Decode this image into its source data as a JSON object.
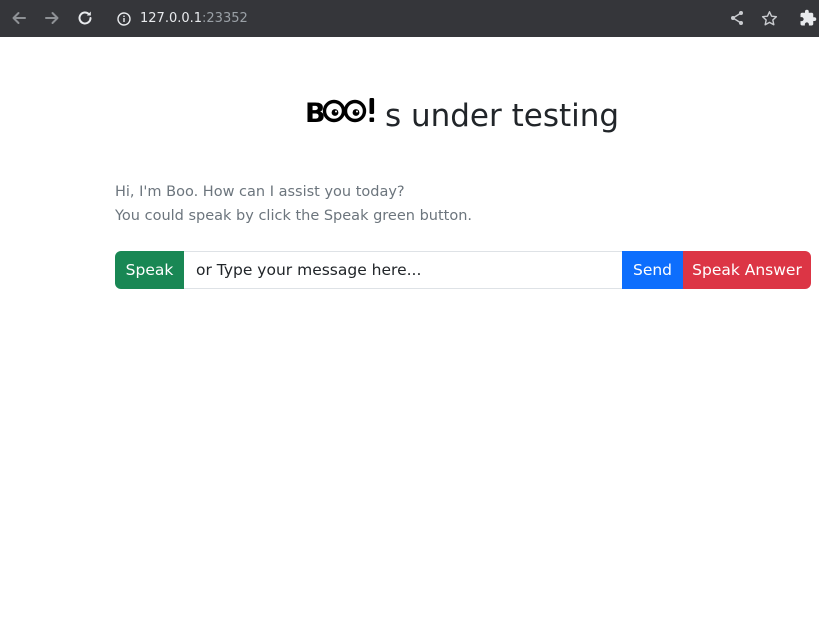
{
  "browser": {
    "url_host": "127.0.0.1",
    "url_port": ":23352",
    "icons": [
      "back-icon",
      "forward-icon",
      "reload-icon",
      "info-icon",
      "share-icon",
      "bookmark-star-icon",
      "extensions-icon"
    ]
  },
  "header": {
    "logo_text": "BOO!",
    "title": "s under testing"
  },
  "greeting": {
    "line1": "Hi, I'm Boo. How can I assist you today?",
    "line2": "You could speak by click the Speak green button."
  },
  "chat": {
    "speak_label": "Speak",
    "input_placeholder": "or Type your message here...",
    "input_value": "",
    "send_label": "Send",
    "speak_answer_label": "Speak Answer"
  },
  "colors": {
    "speak": "#198754",
    "send": "#0d6efd",
    "speak_answer": "#dc3545",
    "toolbar": "#35363a"
  }
}
